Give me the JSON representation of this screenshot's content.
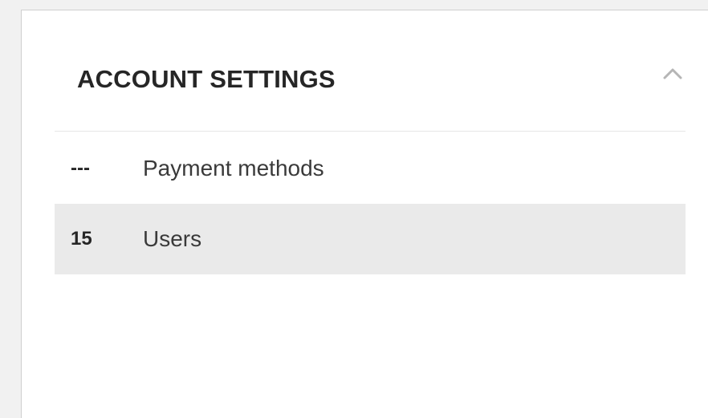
{
  "panel": {
    "title": "ACCOUNT SETTINGS",
    "toggle_icon": "chevron-up-icon",
    "items": [
      {
        "count": "---",
        "label": "Payment methods",
        "active": false
      },
      {
        "count": "15",
        "label": "Users",
        "active": true
      }
    ]
  },
  "colors": {
    "page_background": "#f1f1f1",
    "panel_background": "#ffffff",
    "active_row": "#eaeaea",
    "title_text": "#262626",
    "icon": "#b5b5b5"
  }
}
